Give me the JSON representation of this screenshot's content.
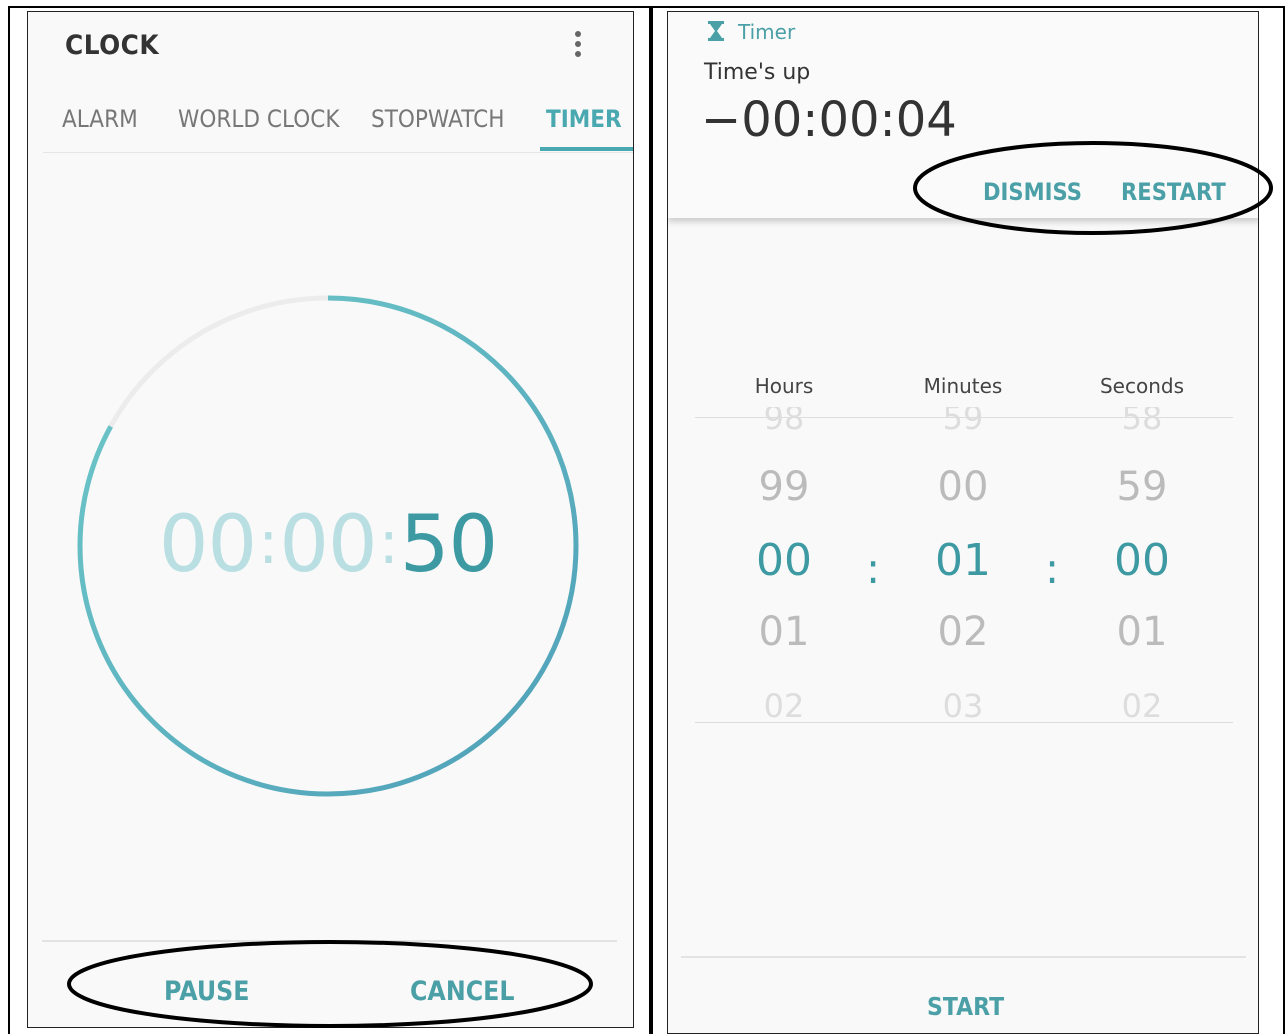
{
  "left": {
    "app_title": "CLOCK",
    "tabs": [
      {
        "label": "ALARM",
        "active": false
      },
      {
        "label": "WORLD CLOCK",
        "active": false
      },
      {
        "label": "STOPWATCH",
        "active": false
      },
      {
        "label": "TIMER",
        "active": true
      }
    ],
    "timer": {
      "hours": "00",
      "minutes": "00",
      "seconds": "50",
      "separator": ":",
      "progress_remaining": 0.83
    },
    "actions": {
      "pause": "PAUSE",
      "cancel": "CANCEL"
    }
  },
  "right": {
    "notification": {
      "app_name": "Timer",
      "title": "Time's up",
      "overtime": "−00:00:04",
      "dismiss": "DISMISS",
      "restart": "RESTART"
    },
    "picker": {
      "separator": ":",
      "columns": [
        {
          "header": "Hours",
          "values": [
            "98",
            "99",
            "00",
            "01",
            "02"
          ]
        },
        {
          "header": "Minutes",
          "values": [
            "59",
            "00",
            "01",
            "02",
            "03"
          ]
        },
        {
          "header": "Seconds",
          "values": [
            "58",
            "59",
            "00",
            "01",
            "02"
          ]
        }
      ]
    },
    "start": "START"
  },
  "colors": {
    "accent": "#4aa9b0",
    "accent_dark": "#3d9aa3",
    "ring_start": "#4e9fb8",
    "ring_end": "#6ec9c9",
    "ring_track": "#ececec"
  },
  "icons": {
    "overflow": "more-vert-icon",
    "timer_app": "hourglass-icon"
  }
}
